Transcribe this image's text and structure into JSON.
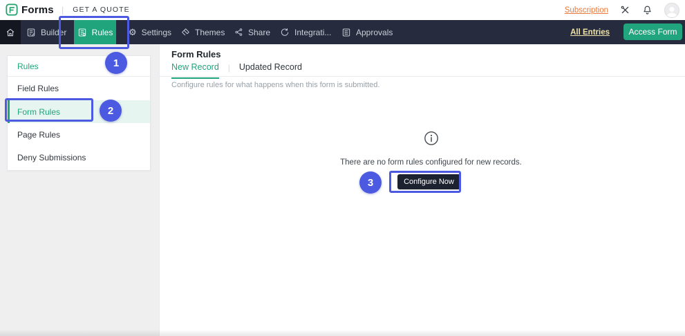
{
  "topbar": {
    "brand": "Forms",
    "quote_label": "GET A QUOTE",
    "subscription_label": "Subscription"
  },
  "navbar": {
    "items": [
      {
        "label": "Builder",
        "icon": "builder-icon",
        "active": false
      },
      {
        "label": "Rules",
        "icon": "rules-icon",
        "active": true
      },
      {
        "label": "Settings",
        "icon": "settings-icon",
        "active": false
      },
      {
        "label": "Themes",
        "icon": "themes-icon",
        "active": false
      },
      {
        "label": "Share",
        "icon": "share-icon",
        "active": false
      },
      {
        "label": "Integrati...",
        "icon": "integrations-icon",
        "active": false
      },
      {
        "label": "Approvals",
        "icon": "approvals-icon",
        "active": false
      }
    ],
    "all_entries_label": "All Entries",
    "access_form_label": "Access Form"
  },
  "sidebar": {
    "header": "Rules",
    "items": [
      {
        "label": "Field Rules",
        "selected": false
      },
      {
        "label": "Form Rules",
        "selected": true
      },
      {
        "label": "Page Rules",
        "selected": false
      },
      {
        "label": "Deny Submissions",
        "selected": false
      }
    ]
  },
  "main": {
    "title": "Form Rules",
    "tabs": [
      {
        "label": "New Record",
        "active": true
      },
      {
        "label": "Updated Record",
        "active": false
      }
    ],
    "description": "Configure rules for what happens when this form is submitted.",
    "empty_state": {
      "icon": "info-icon",
      "message": "There are no form rules configured for new records.",
      "button_label": "Configure Now"
    }
  },
  "annotations": {
    "steps": [
      "1",
      "2",
      "3"
    ]
  },
  "icons": {
    "logo": "forms-logo green rounded square with F",
    "home": "house outline",
    "tools": "crossed wrench and screwdriver",
    "bell": "notification bell outline",
    "avatar": "user silhouette in circle",
    "info": "circled lowercase i"
  },
  "colors": {
    "accent_green": "#1fa47c",
    "nav_background": "#262c3d",
    "annotation_blue": "#4b5ae0",
    "subscription_orange": "#e8793a",
    "all_entries_yellow": "#f0e2a8",
    "dark_button": "#1d2230",
    "selected_row_bg": "#e7f5f0"
  }
}
